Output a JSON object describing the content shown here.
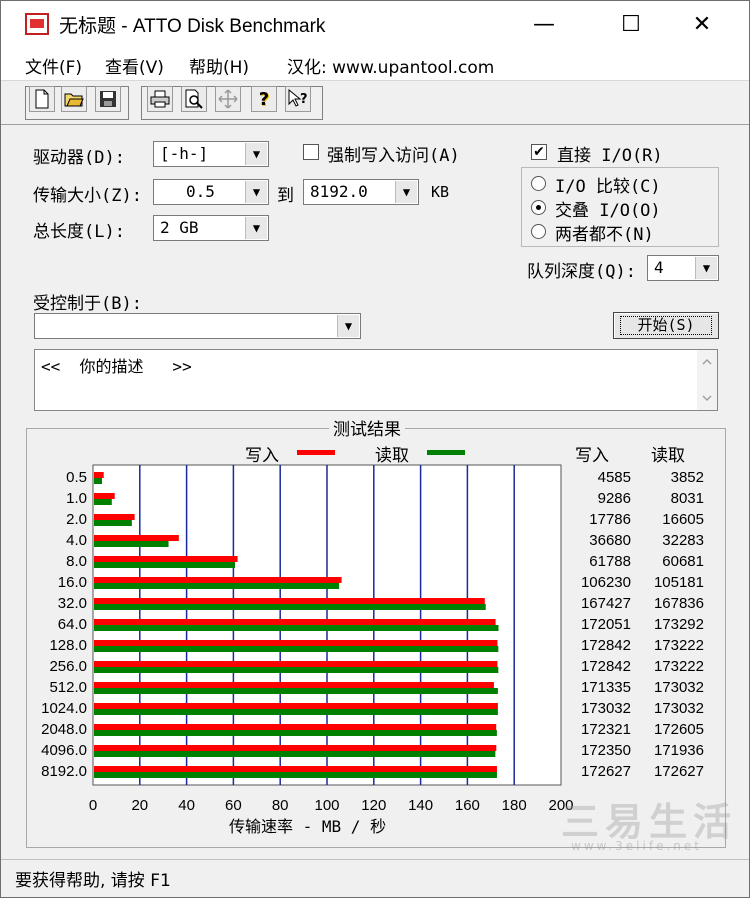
{
  "window": {
    "title": "无标题 - ATTO Disk Benchmark",
    "minimize": "—",
    "maximize": "☐",
    "close": "✕"
  },
  "menu": [
    "文件(F)",
    "查看(V)",
    "帮助(H)",
    "汉化: www.upantool.com"
  ],
  "toolbar": {
    "icons": [
      "new-file-icon",
      "open-folder-icon",
      "save-icon",
      "print-icon",
      "print-preview-icon",
      "move-icon",
      "help-icon",
      "context-help-icon"
    ]
  },
  "form": {
    "drive_label": "驱动器(D):",
    "drive_value": "[-h-]",
    "force_write_label": "强制写入访问(A)",
    "force_write_checked": false,
    "direct_io_label": "直接 I/O(R)",
    "direct_io_checked": true,
    "transfer_label": "传输大小(Z):",
    "transfer_from": "0.5",
    "transfer_to_label": "到",
    "transfer_to": "8192.0",
    "transfer_unit": "KB",
    "total_length_label": "总长度(L):",
    "total_length_value": "2 GB",
    "io_compare_label": "I/O 比较(C)",
    "io_overlap_label": "交叠 I/O(O)",
    "io_neither_label": "两者都不(N)",
    "selected_io": "io_overlap",
    "queue_depth_label": "队列深度(Q):",
    "queue_depth_value": "4",
    "controlled_by_label": "受控制于(B):",
    "controlled_by_value": "",
    "start_button": "开始(S)",
    "description": "<<  你的描述   >>"
  },
  "results": {
    "title": "测试结果",
    "write_legend": "写入",
    "read_legend": "读取",
    "write_col_header": "写入",
    "read_col_header": "读取",
    "write_color": "#ff0000",
    "read_color": "#008000"
  },
  "chart_data": {
    "type": "bar",
    "orientation": "horizontal",
    "categories": [
      "0.5",
      "1.0",
      "2.0",
      "4.0",
      "8.0",
      "16.0",
      "32.0",
      "64.0",
      "128.0",
      "256.0",
      "512.0",
      "1024.0",
      "2048.0",
      "4096.0",
      "8192.0"
    ],
    "series": [
      {
        "name": "写入",
        "values": [
          4585,
          9286,
          17786,
          36680,
          61788,
          106230,
          167427,
          172051,
          172842,
          172842,
          171335,
          173032,
          172321,
          172350,
          172627
        ]
      },
      {
        "name": "读取",
        "values": [
          3852,
          8031,
          16605,
          32283,
          60681,
          105181,
          167836,
          173292,
          173222,
          173222,
          173032,
          173032,
          172605,
          171936,
          172627
        ]
      }
    ],
    "xticks": [
      "0",
      "20",
      "40",
      "60",
      "80",
      "100",
      "120",
      "140",
      "160",
      "180",
      "200"
    ],
    "xlim": [
      0,
      200
    ],
    "xlabel": "传输速率 - MB / 秒",
    "value_scale_divisor": 1000
  },
  "status": "要获得帮助, 请按 F1",
  "watermark": {
    "main": "三易生活",
    "sub": "www.3elife.net"
  }
}
